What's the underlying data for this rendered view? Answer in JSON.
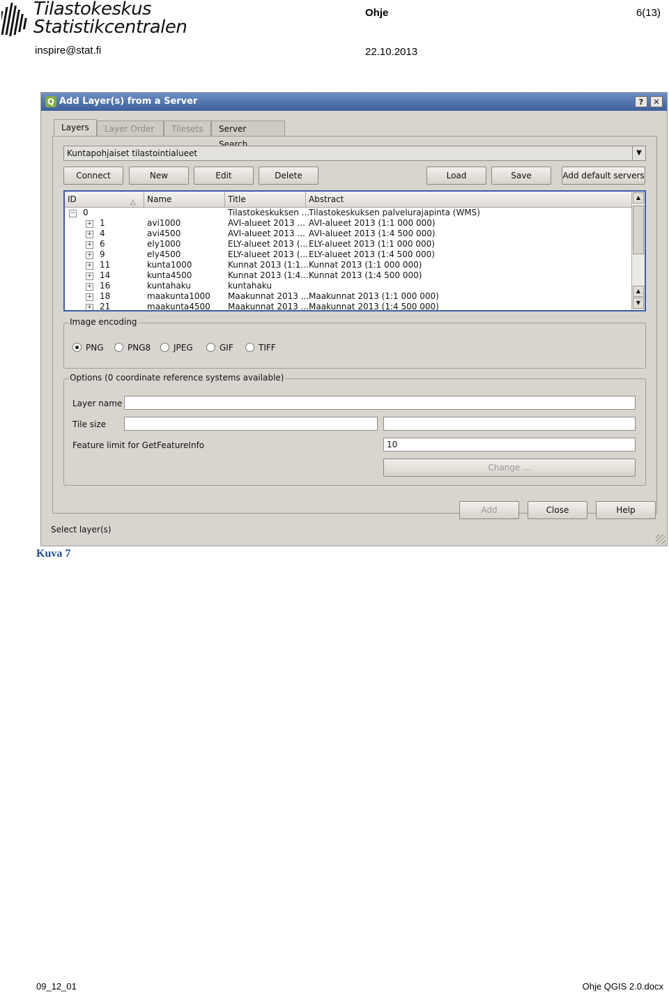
{
  "header": {
    "logo_line1": "Tilastokeskus",
    "logo_line2": "Statistikcentralen",
    "email": "inspire@stat.fi",
    "doc_type": "Ohje",
    "date": "22.10.2013",
    "page": "6(13)"
  },
  "dialog": {
    "title": "Add Layer(s) from a Server",
    "help_btn": "?",
    "close_btn": "✕",
    "tabs": [
      "Layers",
      "Layer Order",
      "Tilesets",
      "Server Search"
    ],
    "server_combo": "Kuntapohjaiset tilastointialueet",
    "buttons": {
      "connect": "Connect",
      "new": "New",
      "edit": "Edit",
      "delete": "Delete",
      "load": "Load",
      "save": "Save",
      "add_default": "Add default servers"
    },
    "columns": [
      "ID",
      "Name",
      "Title",
      "Abstract"
    ],
    "rows": [
      {
        "id": "0",
        "name": "",
        "title": "Tilastokeskuksen ...",
        "abstract": "Tilastokeskuksen palvelurajapinta (WMS)",
        "root": true
      },
      {
        "id": "1",
        "name": "avi1000",
        "title": "AVI-alueet 2013 ...",
        "abstract": "AVI-alueet 2013 (1:1 000 000)"
      },
      {
        "id": "4",
        "name": "avi4500",
        "title": "AVI-alueet 2013 ...",
        "abstract": "AVI-alueet 2013 (1:4 500 000)"
      },
      {
        "id": "6",
        "name": "ely1000",
        "title": "ELY-alueet 2013 (...",
        "abstract": "ELY-alueet 2013 (1:1 000 000)"
      },
      {
        "id": "9",
        "name": "ely4500",
        "title": "ELY-alueet 2013 (...",
        "abstract": "ELY-alueet 2013 (1:4 500 000)"
      },
      {
        "id": "11",
        "name": "kunta1000",
        "title": "Kunnat 2013 (1:1...",
        "abstract": "Kunnat 2013 (1:1 000 000)"
      },
      {
        "id": "14",
        "name": "kunta4500",
        "title": "Kunnat 2013 (1:4...",
        "abstract": "Kunnat 2013 (1:4 500 000)"
      },
      {
        "id": "16",
        "name": "kuntahaku",
        "title": "kuntahaku",
        "abstract": ""
      },
      {
        "id": "18",
        "name": "maakunta1000",
        "title": "Maakunnat 2013 ...",
        "abstract": "Maakunnat 2013 (1:1 000 000)"
      },
      {
        "id": "21",
        "name": "maakunta4500",
        "title": "Maakunnat 2013 ...",
        "abstract": "Maakunnat 2013 (1:4 500 000)"
      }
    ],
    "image_encoding": {
      "title": "Image encoding",
      "options": [
        "PNG",
        "PNG8",
        "JPEG",
        "GIF",
        "TIFF"
      ],
      "selected": "PNG"
    },
    "options": {
      "title": "Options (0 coordinate reference systems available)",
      "layer_name_label": "Layer name",
      "layer_name_value": "",
      "tile_size_label": "Tile size",
      "tile_w": "",
      "tile_h": "",
      "feature_limit_label": "Feature limit for GetFeatureInfo",
      "feature_limit_value": "10",
      "change_btn": "Change ..."
    },
    "bottom_buttons": {
      "add": "Add",
      "close": "Close",
      "help": "Help"
    },
    "status": "Select layer(s)"
  },
  "caption": "Kuva 7",
  "footer": {
    "left": "09_12_01",
    "right": "Ohje QGIS 2.0.docx"
  }
}
